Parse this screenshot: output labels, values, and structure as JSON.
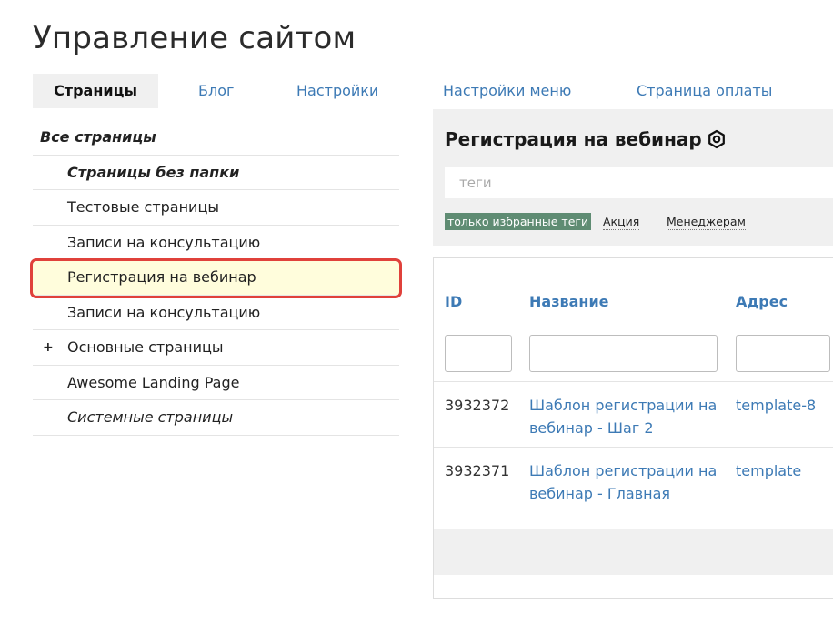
{
  "page": {
    "title": "Управление сайтом"
  },
  "tabs": [
    {
      "label": "Страницы",
      "active": true
    },
    {
      "label": "Блог"
    },
    {
      "label": "Настройки"
    },
    {
      "label": "Настройки меню"
    },
    {
      "label": "Страница оплаты"
    }
  ],
  "sidebar": {
    "items": [
      {
        "label": "Все страницы"
      },
      {
        "label": "Страницы без папки"
      },
      {
        "label": "Тестовые страницы"
      },
      {
        "label": "Записи на консультацию"
      },
      {
        "label": "Регистрация на вебинар",
        "selected": true
      },
      {
        "label": "Записи на консультацию"
      },
      {
        "label": "Основные страницы",
        "expander": "+"
      },
      {
        "label": "Awesome Landing Page"
      },
      {
        "label": "Системные страницы"
      }
    ]
  },
  "panel": {
    "title": "Регистрация на вебинар",
    "settings_icon": "gear-icon",
    "tags_placeholder": "теги",
    "favorite_tags_label": "только избранные теги",
    "favorite_tags_color": "#5f8c73",
    "tags": [
      "Акция",
      "Менеджерам"
    ]
  },
  "table": {
    "columns": [
      "ID",
      "Название",
      "Адрес"
    ],
    "rows": [
      {
        "id": "3932372",
        "name": "Шаблон регистрации на вебинар - Шаг 2",
        "address": "template-8"
      },
      {
        "id": "3932371",
        "name": "Шаблон регистрации на вебинар - Главная",
        "address": "template"
      }
    ]
  },
  "colors": {
    "link": "#3d7ab5",
    "selected_bg": "#fffddc",
    "highlight_border": "#e0413b"
  }
}
